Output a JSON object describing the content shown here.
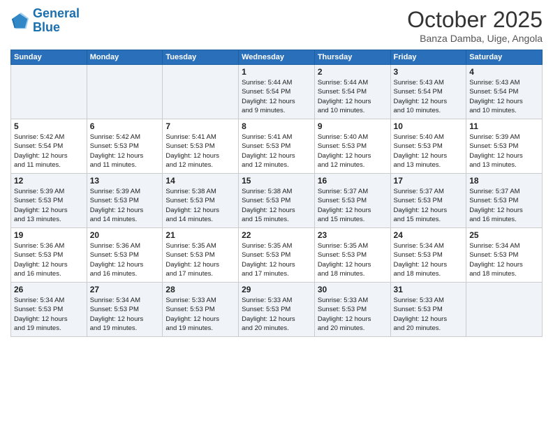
{
  "logo": {
    "line1": "General",
    "line2": "Blue"
  },
  "title": "October 2025",
  "location": "Banza Damba, Uige, Angola",
  "days_of_week": [
    "Sunday",
    "Monday",
    "Tuesday",
    "Wednesday",
    "Thursday",
    "Friday",
    "Saturday"
  ],
  "weeks": [
    [
      {
        "day": "",
        "text": ""
      },
      {
        "day": "",
        "text": ""
      },
      {
        "day": "",
        "text": ""
      },
      {
        "day": "1",
        "text": "Sunrise: 5:44 AM\nSunset: 5:54 PM\nDaylight: 12 hours\nand 9 minutes."
      },
      {
        "day": "2",
        "text": "Sunrise: 5:44 AM\nSunset: 5:54 PM\nDaylight: 12 hours\nand 10 minutes."
      },
      {
        "day": "3",
        "text": "Sunrise: 5:43 AM\nSunset: 5:54 PM\nDaylight: 12 hours\nand 10 minutes."
      },
      {
        "day": "4",
        "text": "Sunrise: 5:43 AM\nSunset: 5:54 PM\nDaylight: 12 hours\nand 10 minutes."
      }
    ],
    [
      {
        "day": "5",
        "text": "Sunrise: 5:42 AM\nSunset: 5:54 PM\nDaylight: 12 hours\nand 11 minutes."
      },
      {
        "day": "6",
        "text": "Sunrise: 5:42 AM\nSunset: 5:53 PM\nDaylight: 12 hours\nand 11 minutes."
      },
      {
        "day": "7",
        "text": "Sunrise: 5:41 AM\nSunset: 5:53 PM\nDaylight: 12 hours\nand 12 minutes."
      },
      {
        "day": "8",
        "text": "Sunrise: 5:41 AM\nSunset: 5:53 PM\nDaylight: 12 hours\nand 12 minutes."
      },
      {
        "day": "9",
        "text": "Sunrise: 5:40 AM\nSunset: 5:53 PM\nDaylight: 12 hours\nand 12 minutes."
      },
      {
        "day": "10",
        "text": "Sunrise: 5:40 AM\nSunset: 5:53 PM\nDaylight: 12 hours\nand 13 minutes."
      },
      {
        "day": "11",
        "text": "Sunrise: 5:39 AM\nSunset: 5:53 PM\nDaylight: 12 hours\nand 13 minutes."
      }
    ],
    [
      {
        "day": "12",
        "text": "Sunrise: 5:39 AM\nSunset: 5:53 PM\nDaylight: 12 hours\nand 13 minutes."
      },
      {
        "day": "13",
        "text": "Sunrise: 5:39 AM\nSunset: 5:53 PM\nDaylight: 12 hours\nand 14 minutes."
      },
      {
        "day": "14",
        "text": "Sunrise: 5:38 AM\nSunset: 5:53 PM\nDaylight: 12 hours\nand 14 minutes."
      },
      {
        "day": "15",
        "text": "Sunrise: 5:38 AM\nSunset: 5:53 PM\nDaylight: 12 hours\nand 15 minutes."
      },
      {
        "day": "16",
        "text": "Sunrise: 5:37 AM\nSunset: 5:53 PM\nDaylight: 12 hours\nand 15 minutes."
      },
      {
        "day": "17",
        "text": "Sunrise: 5:37 AM\nSunset: 5:53 PM\nDaylight: 12 hours\nand 15 minutes."
      },
      {
        "day": "18",
        "text": "Sunrise: 5:37 AM\nSunset: 5:53 PM\nDaylight: 12 hours\nand 16 minutes."
      }
    ],
    [
      {
        "day": "19",
        "text": "Sunrise: 5:36 AM\nSunset: 5:53 PM\nDaylight: 12 hours\nand 16 minutes."
      },
      {
        "day": "20",
        "text": "Sunrise: 5:36 AM\nSunset: 5:53 PM\nDaylight: 12 hours\nand 16 minutes."
      },
      {
        "day": "21",
        "text": "Sunrise: 5:35 AM\nSunset: 5:53 PM\nDaylight: 12 hours\nand 17 minutes."
      },
      {
        "day": "22",
        "text": "Sunrise: 5:35 AM\nSunset: 5:53 PM\nDaylight: 12 hours\nand 17 minutes."
      },
      {
        "day": "23",
        "text": "Sunrise: 5:35 AM\nSunset: 5:53 PM\nDaylight: 12 hours\nand 18 minutes."
      },
      {
        "day": "24",
        "text": "Sunrise: 5:34 AM\nSunset: 5:53 PM\nDaylight: 12 hours\nand 18 minutes."
      },
      {
        "day": "25",
        "text": "Sunrise: 5:34 AM\nSunset: 5:53 PM\nDaylight: 12 hours\nand 18 minutes."
      }
    ],
    [
      {
        "day": "26",
        "text": "Sunrise: 5:34 AM\nSunset: 5:53 PM\nDaylight: 12 hours\nand 19 minutes."
      },
      {
        "day": "27",
        "text": "Sunrise: 5:34 AM\nSunset: 5:53 PM\nDaylight: 12 hours\nand 19 minutes."
      },
      {
        "day": "28",
        "text": "Sunrise: 5:33 AM\nSunset: 5:53 PM\nDaylight: 12 hours\nand 19 minutes."
      },
      {
        "day": "29",
        "text": "Sunrise: 5:33 AM\nSunset: 5:53 PM\nDaylight: 12 hours\nand 20 minutes."
      },
      {
        "day": "30",
        "text": "Sunrise: 5:33 AM\nSunset: 5:53 PM\nDaylight: 12 hours\nand 20 minutes."
      },
      {
        "day": "31",
        "text": "Sunrise: 5:33 AM\nSunset: 5:53 PM\nDaylight: 12 hours\nand 20 minutes."
      },
      {
        "day": "",
        "text": ""
      }
    ]
  ]
}
